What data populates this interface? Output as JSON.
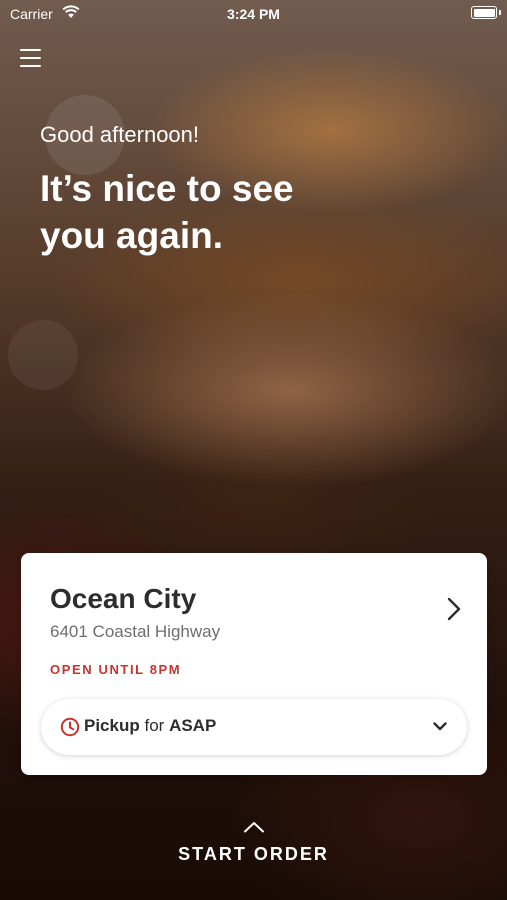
{
  "status_bar": {
    "carrier": "Carrier",
    "time": "3:24 PM"
  },
  "hero": {
    "greeting": "Good afternoon!",
    "headline": "It’s nice to see you again."
  },
  "location": {
    "name": "Ocean City",
    "address": "6401 Coastal Highway",
    "status": "OPEN UNTIL 8PM"
  },
  "pickup": {
    "mode": "Pickup",
    "connector": "for",
    "time": "ASAP"
  },
  "start_order_label": "START ORDER",
  "colors": {
    "accent": "#c8342c",
    "card_text": "#2d2d2d",
    "muted_text": "#6e6e6e"
  },
  "icons": [
    "wifi-icon",
    "battery-icon",
    "hamburger-menu-icon",
    "chevron-right-icon",
    "clock-icon",
    "chevron-down-icon",
    "chevron-up-icon"
  ]
}
